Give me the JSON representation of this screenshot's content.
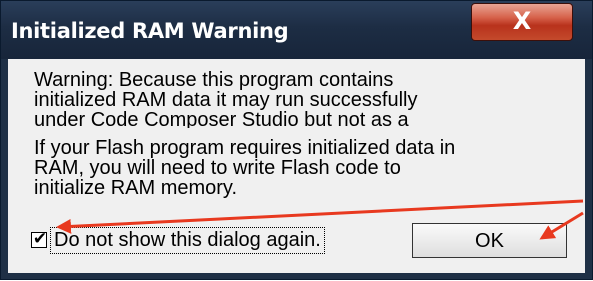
{
  "window": {
    "title": "Initialized RAM Warning",
    "close_glyph": "X"
  },
  "message": {
    "paragraph1": "Warning: Because this program contains\ninitialized RAM data it may run successfully\nunder Code Composer Studio but not as a\nstandalone application.",
    "paragraph2": "If your Flash program requires initialized data in\nRAM, you will need to write Flash code to\ninitialize RAM memory."
  },
  "checkbox": {
    "label": "Do not show this dialog again.",
    "checked": true,
    "mark": "✔"
  },
  "ok_button": {
    "label": "OK"
  },
  "colors": {
    "annotation_arrow": "#e8391f",
    "titlebar": "#1d2d44",
    "close_button": "#c44a2c",
    "client_background": "#f0f0f0"
  }
}
